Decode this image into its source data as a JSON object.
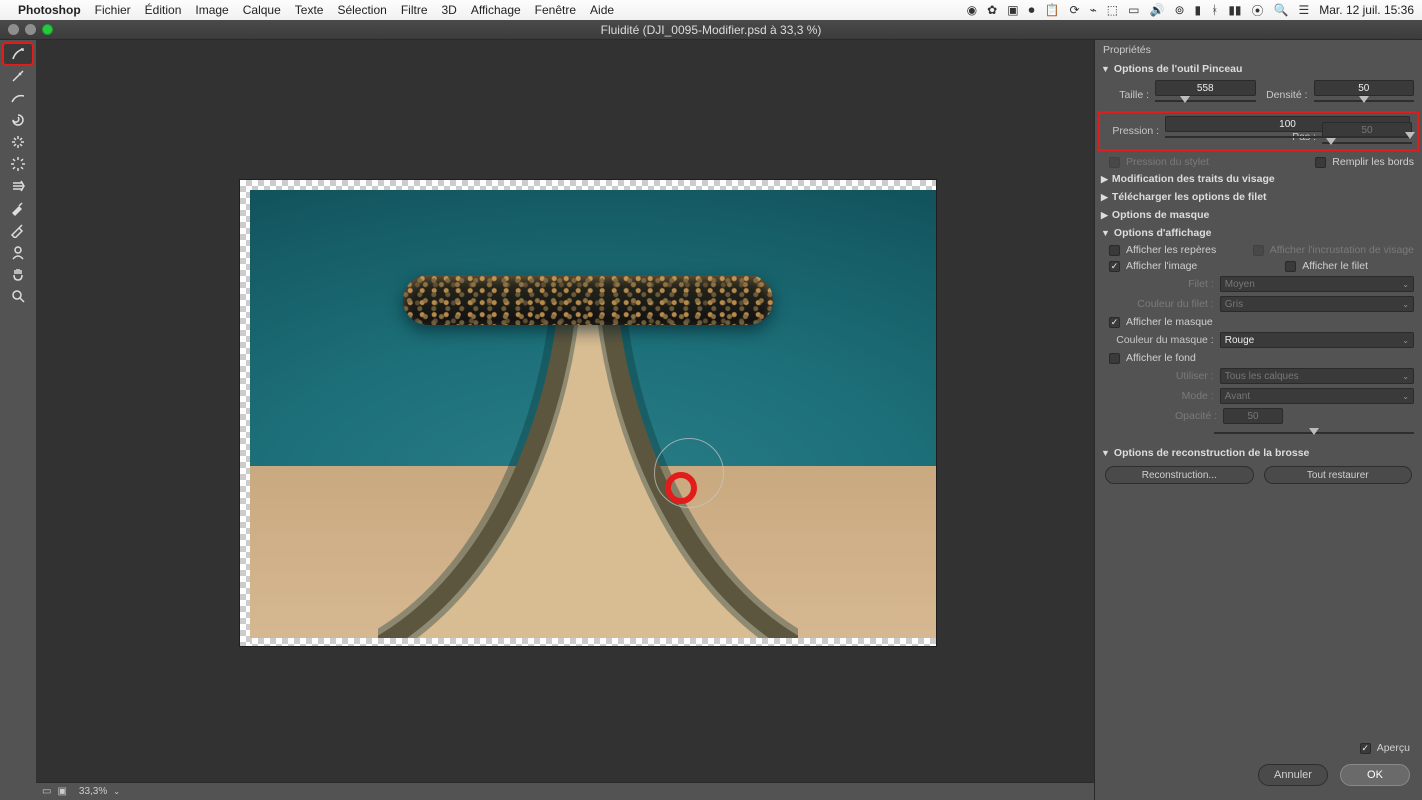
{
  "menubar": {
    "app": "Photoshop",
    "items": [
      "Fichier",
      "Édition",
      "Image",
      "Calque",
      "Texte",
      "Sélection",
      "Filtre",
      "3D",
      "Affichage",
      "Fenêtre",
      "Aide"
    ],
    "clock": "Mar. 12 juil.  15:36"
  },
  "window": {
    "title": "Fluidité (DJI_0095-Modifier.psd à 33,3 %)"
  },
  "statusbar": {
    "zoom": "33,3%"
  },
  "panel": {
    "header": "Propriétés",
    "brush": {
      "title": "Options de l'outil Pinceau",
      "size_label": "Taille :",
      "size_value": "558",
      "density_label": "Densité :",
      "density_value": "50",
      "pressure_label": "Pression :",
      "pressure_value": "100",
      "step_label": "Pas :",
      "step_value": "50",
      "stylus_label": "Pression du stylet",
      "pinedges_label": "Remplir les bords"
    },
    "collapsed": {
      "face": "Modification des traits du visage",
      "mesh": "Télécharger les options de filet",
      "mask": "Options de masque"
    },
    "view": {
      "title": "Options d'affichage",
      "guides": "Afficher les repères",
      "face_overlay": "Afficher l'incrustation de visage",
      "image": "Afficher l'image",
      "mesh": "Afficher le filet",
      "meshsize_label": "Filet :",
      "meshsize_value": "Moyen",
      "meshcolor_label": "Couleur du filet :",
      "meshcolor_value": "Gris",
      "showmask": "Afficher le masque",
      "maskcolor_label": "Couleur du masque :",
      "maskcolor_value": "Rouge",
      "showbg": "Afficher le fond",
      "use_label": "Utiliser :",
      "use_value": "Tous les calques",
      "mode_label": "Mode :",
      "mode_value": "Avant",
      "opacity_label": "Opacité :",
      "opacity_value": "50"
    },
    "reconstruct": {
      "title": "Options de reconstruction de la brosse",
      "btn1": "Reconstruction...",
      "btn2": "Tout restaurer"
    },
    "preview": "Aperçu",
    "cancel": "Annuler",
    "ok": "OK"
  },
  "colors": {
    "accent_red": "#e21b1b"
  }
}
